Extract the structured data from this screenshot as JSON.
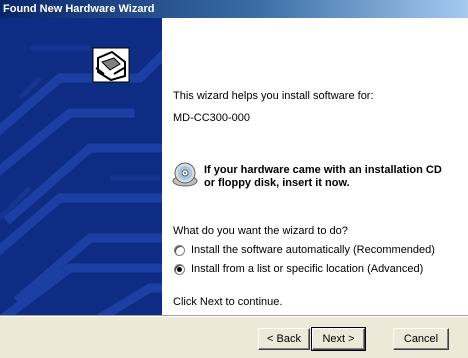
{
  "window": {
    "title": "Found New Hardware Wizard"
  },
  "content": {
    "intro": "This wizard helps you install software for:",
    "device_name": "MD-CC300-000",
    "cd_prompt_line1": "If your hardware came with an installation CD",
    "cd_prompt_line2": "or floppy disk, insert it now.",
    "question": "What do you want the wizard to do?",
    "options": [
      {
        "label": "Install the software automatically (Recommended)",
        "checked": false
      },
      {
        "label": "Install from a list or specific location (Advanced)",
        "checked": true
      }
    ],
    "continue_text": "Click Next to continue."
  },
  "buttons": {
    "back": "< Back",
    "next": "Next >",
    "cancel": "Cancel"
  },
  "icons": {
    "banner": "hardware-card-icon",
    "cd": "cd-disc-icon"
  },
  "colors": {
    "banner_bg": "#0f2c84",
    "title_start": "#0a246a",
    "face": "#ece9d8"
  }
}
